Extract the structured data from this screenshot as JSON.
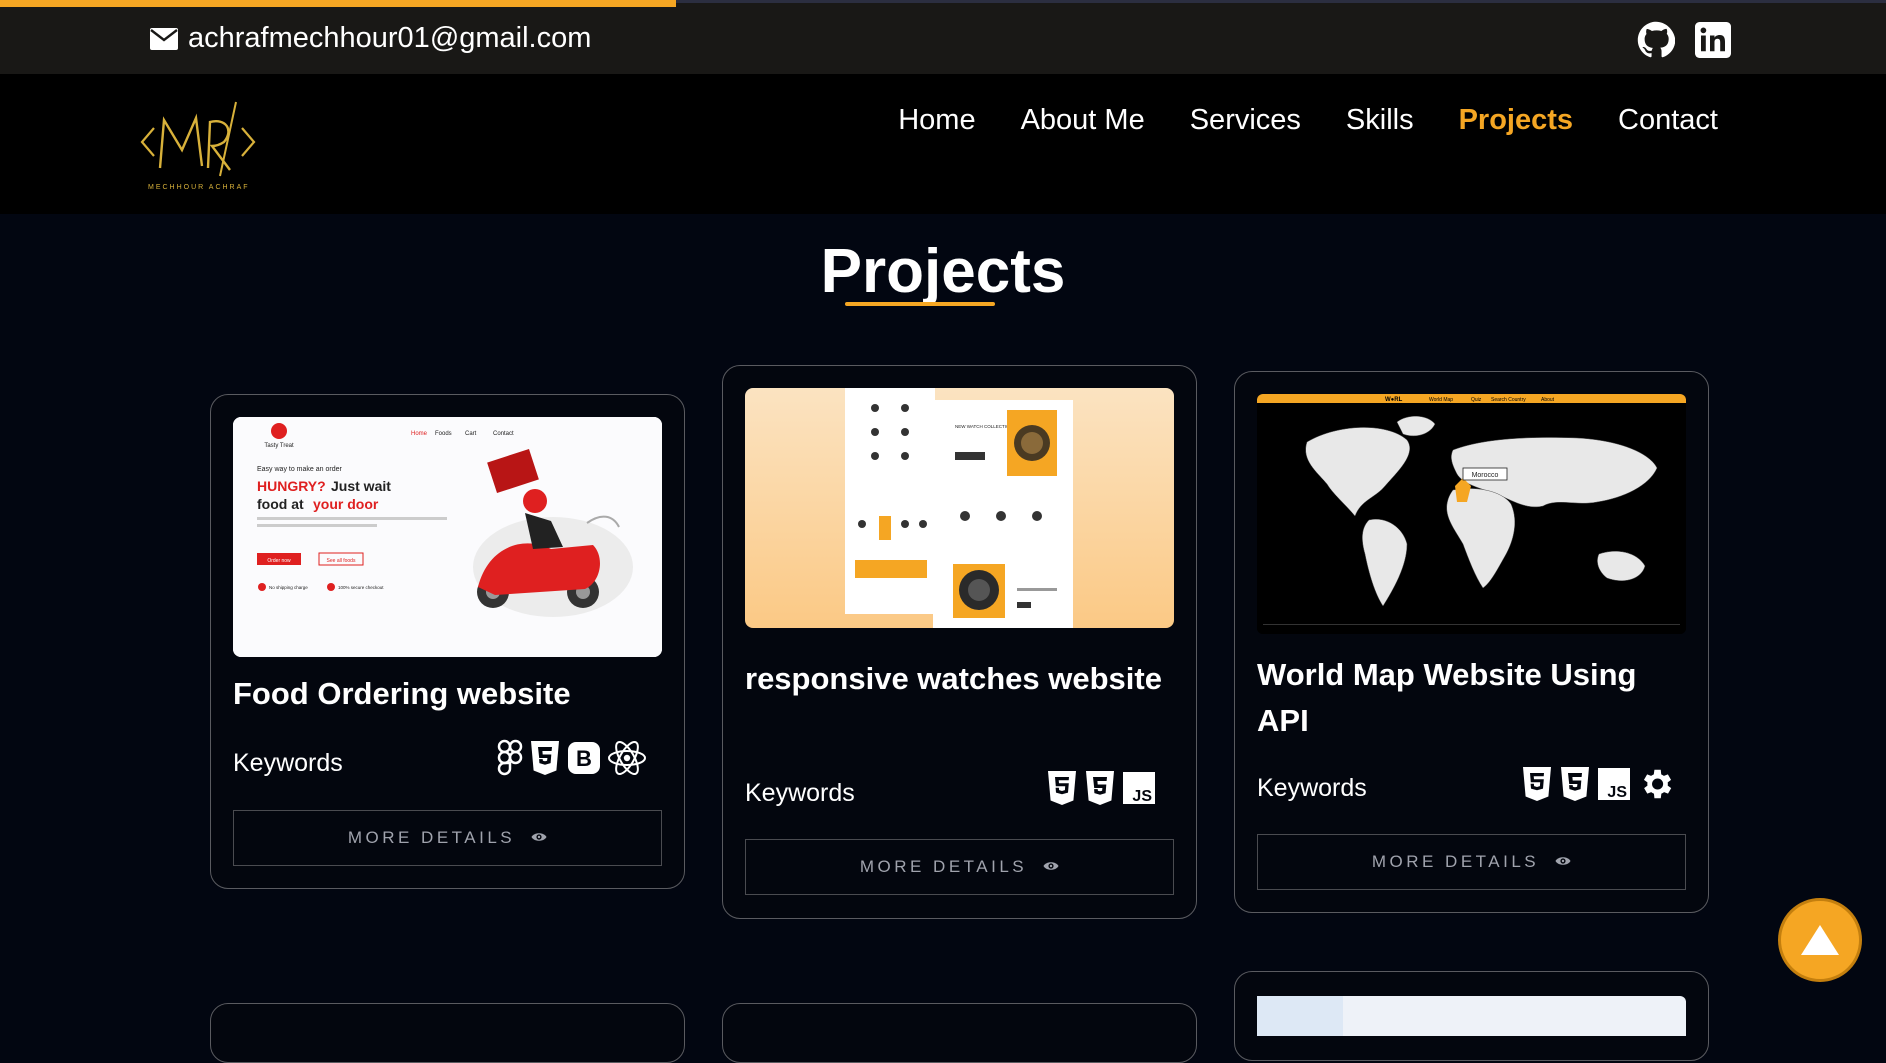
{
  "topbar": {
    "email": "achrafmechhour01@gmail.com",
    "social": [
      "github-icon",
      "linkedin-icon"
    ]
  },
  "logo": {
    "monogram": "MR",
    "caption": "MECHHOUR ACHRAF"
  },
  "nav": {
    "items": [
      "Home",
      "About Me",
      "Services",
      "Skills",
      "Projects",
      "Contact"
    ],
    "active": "Projects"
  },
  "section": {
    "title": "Projects"
  },
  "projects": [
    {
      "title": "Food Ordering website",
      "keywords_label": "Keywords",
      "tech": [
        "figma-icon",
        "css3-icon",
        "bootstrap-icon",
        "react-icon"
      ],
      "button": "MORE DETAILS",
      "preview": {
        "brand": "Tasty Treat",
        "menu": [
          "Home",
          "Foods",
          "Cart",
          "Contact"
        ],
        "kicker": "Easy way to make an order",
        "headline_1": "HUNGRY?",
        "headline_2": "Just wait",
        "headline_3": "food at",
        "headline_4": "your door",
        "cta_primary": "Order now",
        "cta_secondary": "See all foods",
        "badge_1": "No shipping charge",
        "badge_2": "100% secure checkout"
      }
    },
    {
      "title": "responsive watches website",
      "keywords_label": "Keywords",
      "tech": [
        "html5-icon",
        "css3-icon",
        "javascript-icon"
      ],
      "button": "MORE DETAILS",
      "preview": {
        "collection": "NEW WATCH COLLECTIONS 8/24"
      }
    },
    {
      "title": "World Map Website Using API",
      "keywords_label": "Keywords",
      "tech": [
        "html5-icon",
        "css3-icon",
        "javascript-icon",
        "api-gear-icon"
      ],
      "button": "MORE DETAILS",
      "preview": {
        "brand": "W●RL",
        "menu": [
          "World Map",
          "Quiz",
          "Search Country",
          "About"
        ],
        "label": "Morocco"
      }
    }
  ],
  "colors": {
    "accent": "#f5a623",
    "background": "#020611",
    "topbar": "#191816"
  }
}
